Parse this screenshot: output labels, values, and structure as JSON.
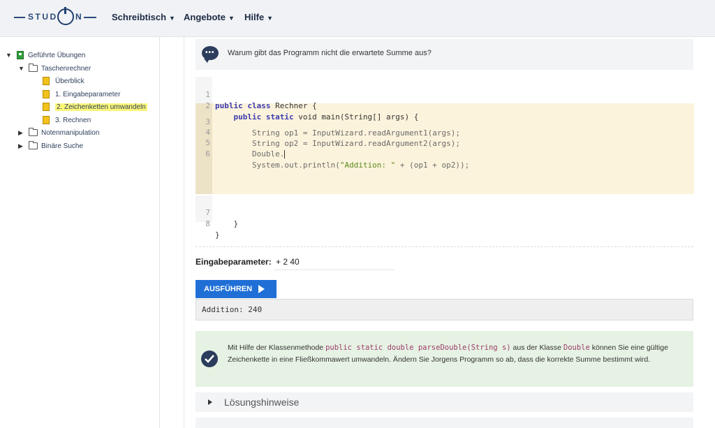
{
  "header": {
    "logo_text_left": "STUD",
    "logo_text_right": "N",
    "nav": [
      {
        "label": "Schreibtisch"
      },
      {
        "label": "Angebote"
      },
      {
        "label": "Hilfe"
      }
    ]
  },
  "sidebar": {
    "root": "Geführte Übungen",
    "folder_open": "Taschenrechner",
    "pages": [
      "Überblick",
      "1. Eingabeparameter",
      "2. Zeichenketten umwandeln",
      "3. Rechnen"
    ],
    "folders_closed": [
      "Notenmanipulation",
      "Binäre Suche"
    ]
  },
  "question": {
    "text": "Warum gibt das Programm nicht die erwartete Summe aus?"
  },
  "editor": {
    "line_numbers": [
      "1",
      "2",
      "3",
      "4",
      "5",
      "6",
      "7",
      "8"
    ],
    "line1_kw": "public class",
    "line1_rest": " Rechner {",
    "line2_kw1": "public static",
    "line2_rest": " void main(String[] args) {",
    "line3": "String op1 = InputWizard.readArgument1(args);",
    "line4": "String op2 = InputWizard.readArgument2(args);",
    "line5": "Double.",
    "line6_a": "System.out.println(",
    "line6_str": "\"Addition: \"",
    "line6_b": " + (op1 + op2));",
    "line7": "}",
    "line8": "}"
  },
  "params": {
    "label": "Eingabeparameter:",
    "value": "+ 2 40"
  },
  "run_button": {
    "label": "AUSFÜHREN"
  },
  "output": {
    "text": "Addition: 240"
  },
  "hint": {
    "part1": "Mit Hilfe der Klassenmethode ",
    "code1": "public static double parseDouble(String s)",
    "part2": " aus der Klasse ",
    "code2": "Double",
    "part3": " können Sie eine gültige Zeichenkette in eine Fließkommawert umwandeln. Ändern Sie Jorgens Programm so ab, dass die korrekte Summe bestimmt wird."
  },
  "solution": {
    "label": "Lösungshinweise"
  }
}
